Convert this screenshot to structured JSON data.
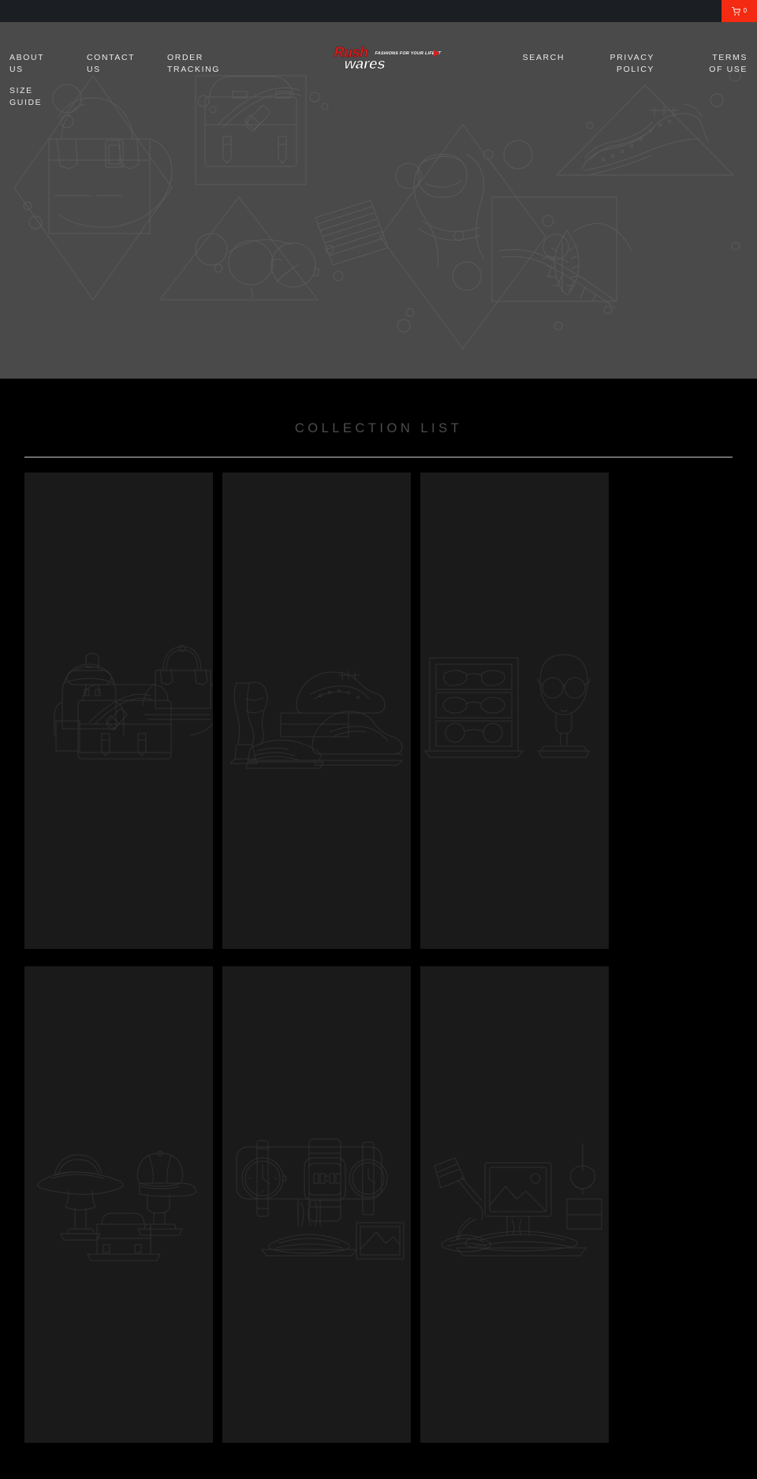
{
  "topbar": {
    "cart": {
      "icon": "shopping-cart-icon",
      "count": "0",
      "color": "#f42a12"
    }
  },
  "header": {
    "logo": {
      "primary": "Rush",
      "secondary": "wares",
      "tagline": "FASHIONS FOR YOUR LIFESTYLE",
      "primary_color": "#d32020",
      "secondary_color": "#ffffff",
      "arrow_color": "#d32020"
    },
    "nav_left": [
      {
        "label": "ABOUT US"
      },
      {
        "label": "CONTACT US"
      },
      {
        "label": "ORDER TRACKING"
      }
    ],
    "nav_left_second_row": [
      {
        "label": "SIZE GUIDE"
      }
    ],
    "nav_right": [
      {
        "label": "SEARCH"
      },
      {
        "label": "PRIVACY POLICY"
      },
      {
        "label": "TERMS OF USE"
      }
    ],
    "background_color": "#4a4a4a"
  },
  "collection": {
    "title": "COLLECTION LIST",
    "background_color": "#000000",
    "card_color": "#1a1a1a",
    "cards": [
      {
        "art": "bags-illustration"
      },
      {
        "art": "shoes-illustration"
      },
      {
        "art": "eyewear-illustration"
      },
      {
        "art": "hats-illustration"
      },
      {
        "art": "watches-illustration"
      },
      {
        "art": "lamp-desk-illustration"
      }
    ]
  }
}
